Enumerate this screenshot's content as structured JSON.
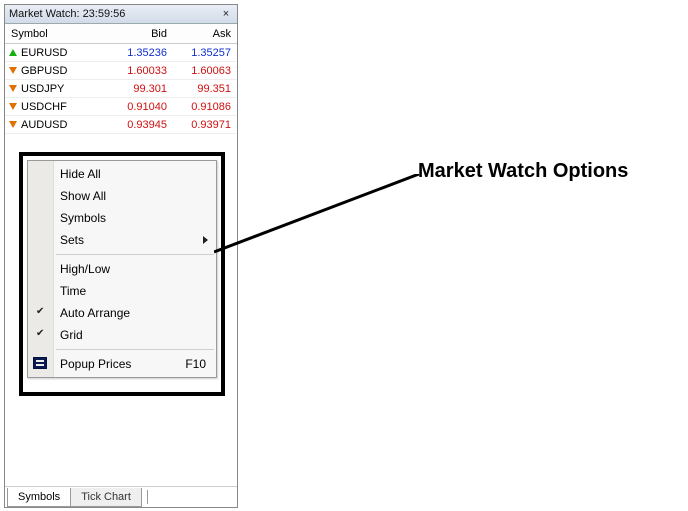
{
  "window": {
    "title_prefix": "Market Watch: ",
    "time": "23:59:56",
    "close_glyph": "×"
  },
  "columns": {
    "symbol": "Symbol",
    "bid": "Bid",
    "ask": "Ask"
  },
  "rows": [
    {
      "symbol": "EURUSD",
      "bid": "1.35236",
      "ask": "1.35257",
      "dir": "up"
    },
    {
      "symbol": "GBPUSD",
      "bid": "1.60033",
      "ask": "1.60063",
      "dir": "down"
    },
    {
      "symbol": "USDJPY",
      "bid": "99.301",
      "ask": "99.351",
      "dir": "down"
    },
    {
      "symbol": "USDCHF",
      "bid": "0.91040",
      "ask": "0.91086",
      "dir": "down"
    },
    {
      "symbol": "AUDUSD",
      "bid": "0.93945",
      "ask": "0.93971",
      "dir": "down"
    }
  ],
  "context_menu": {
    "hide_all": "Hide All",
    "show_all": "Show All",
    "symbols": "Symbols",
    "sets": "Sets",
    "high_low": "High/Low",
    "time": "Time",
    "auto_arrange": "Auto Arrange",
    "grid": "Grid",
    "popup_prices": "Popup Prices",
    "popup_shortcut": "F10",
    "checked": {
      "auto_arrange": true,
      "grid": true
    }
  },
  "tabs": {
    "symbols": "Symbols",
    "tick_chart": "Tick Chart"
  },
  "annotation": {
    "label": "Market Watch Options"
  }
}
